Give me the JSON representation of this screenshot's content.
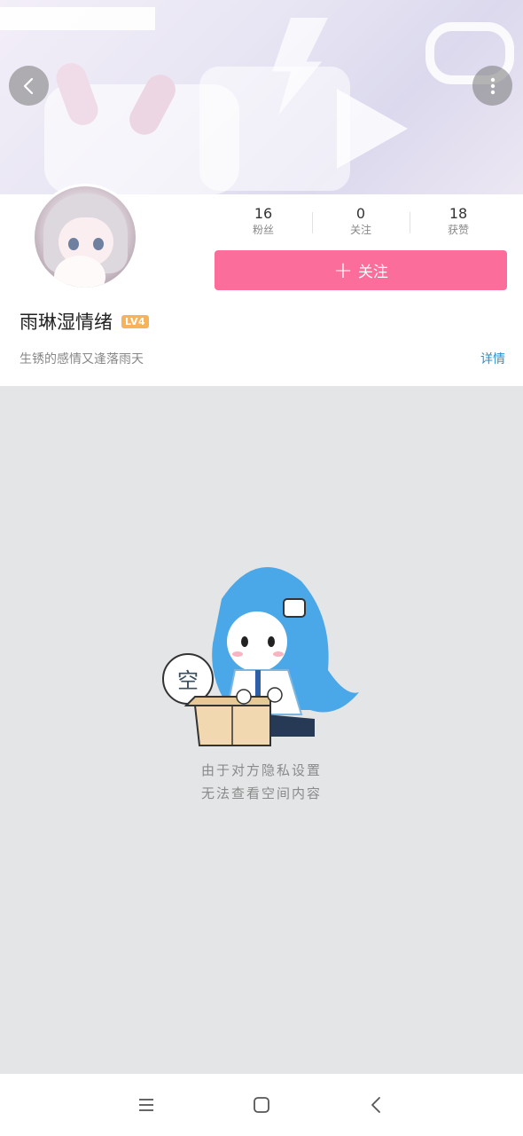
{
  "header": {
    "back_icon": "chevron-left-icon",
    "more_icon": "vertical-dots-icon"
  },
  "profile": {
    "stats": [
      {
        "value": "16",
        "label": "粉丝"
      },
      {
        "value": "0",
        "label": "关注"
      },
      {
        "value": "18",
        "label": "获赞"
      }
    ],
    "follow_label": "关注",
    "username": "雨琳湿情绪",
    "level": "LV4",
    "bio": "生锈的感情又逢落雨天",
    "detail_label": "详情"
  },
  "empty_state": {
    "bubble_text": "空",
    "line1": "由于对方隐私设置",
    "line2": "无法查看空间内容"
  },
  "colors": {
    "accent": "#fb6d9b",
    "link": "#2a8fcf",
    "level_badge": "#f7b25a"
  }
}
